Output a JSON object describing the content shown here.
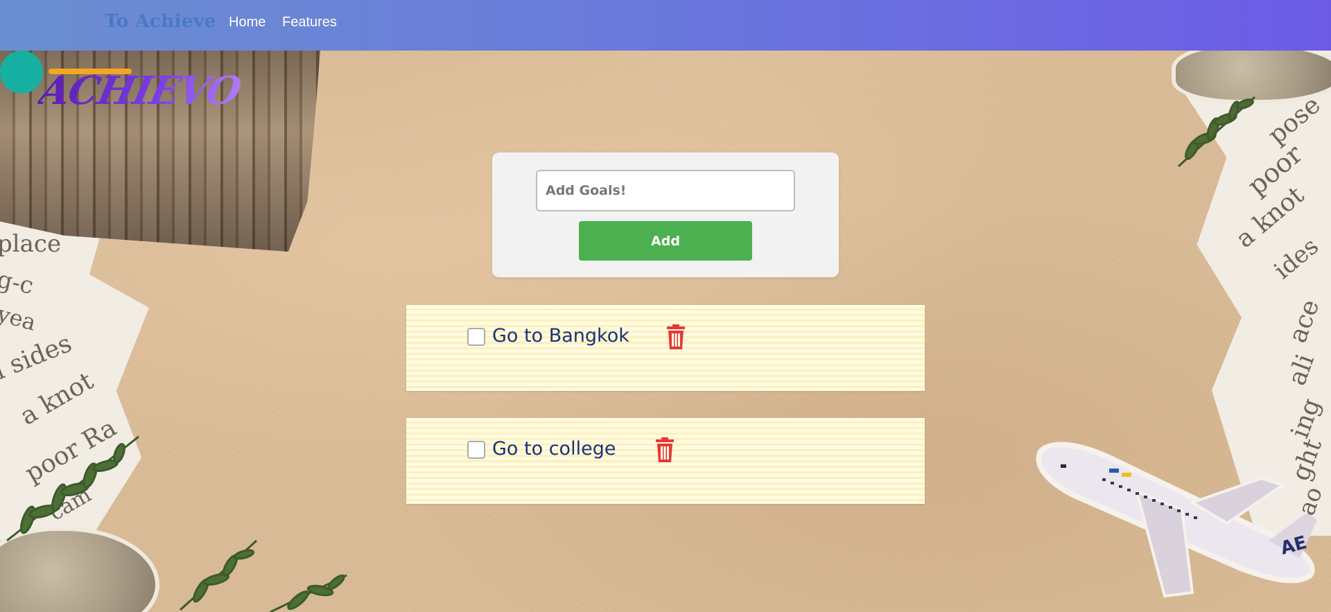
{
  "navbar": {
    "brand": "To Achieve",
    "links": [
      "Home",
      "Features"
    ]
  },
  "logo": {
    "text": "ACHIEVO"
  },
  "decorations": {
    "paper_left_lines": [
      "place",
      "g-c",
      "yea",
      "l sides",
      "a knot",
      "poor Ra",
      "cam"
    ],
    "paper_right_lines": [
      "pose",
      "poor",
      "a knot",
      "ides",
      "ace",
      "ali",
      "ing",
      "ght",
      "ao"
    ]
  },
  "add_form": {
    "input_placeholder": "Add Goals!",
    "input_value": "",
    "add_button_label": "Add"
  },
  "goals": [
    {
      "text": "Go to Bangkok",
      "checked": false
    },
    {
      "text": "Go to college",
      "checked": false
    }
  ],
  "colors": {
    "navbar_start": "#6b8fd0",
    "navbar_end": "#6d5be6",
    "add_button": "#4caf50",
    "delete_icon": "#e53935",
    "goal_text": "#1d3175"
  }
}
